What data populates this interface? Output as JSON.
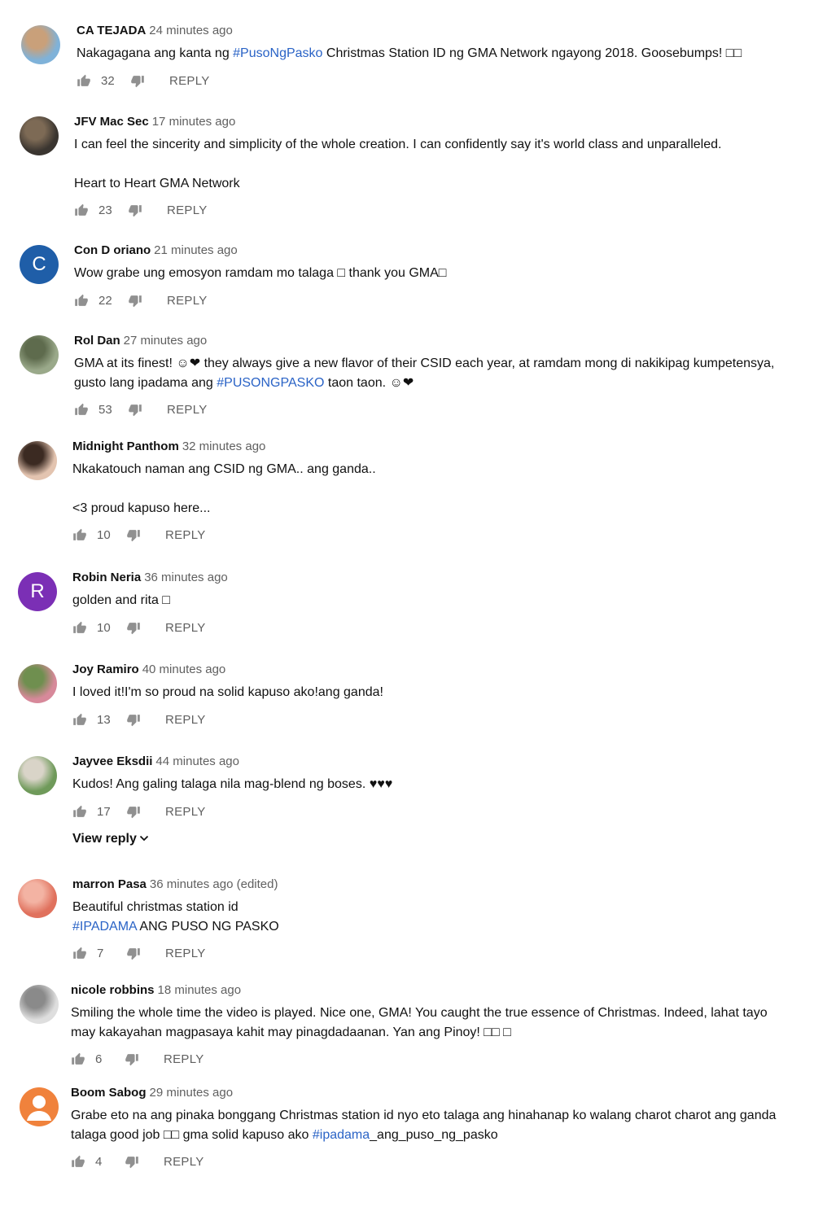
{
  "reply_label": "REPLY",
  "comments": [
    {
      "author": "CA TEJADA",
      "time": "24 minutes ago",
      "likes": "32",
      "avatar": {
        "kind": "photo",
        "colors": [
          "#7fb2d9",
          "#c9a07a"
        ]
      },
      "paragraphs": [
        [
          {
            "t": "Nakagagana ang kanta ng "
          },
          {
            "t": "#PusoNgPasko",
            "link": true
          },
          {
            "t": " Christmas Station ID ng GMA Network ngayong 2018. Goosebumps! □□"
          }
        ]
      ]
    },
    {
      "author": "JFV Mac Sec",
      "time": "17 minutes ago",
      "likes": "23",
      "avatar": {
        "kind": "photo",
        "colors": [
          "#3a3530",
          "#7d6a55"
        ]
      },
      "paragraphs": [
        [
          {
            "t": "I can feel the sincerity and simplicity of the whole creation. I can confidently say it's world class and unparalleled."
          }
        ],
        [
          {
            "t": "Heart to Heart GMA Network"
          }
        ]
      ]
    },
    {
      "author": "Con D oriano",
      "time": "21 minutes ago",
      "likes": "22",
      "avatar": {
        "kind": "letter",
        "letter": "C",
        "color": "#1f5ea8"
      },
      "paragraphs": [
        [
          {
            "t": "Wow grabe ung emosyon ramdam mo talaga □ thank you GMA□"
          }
        ]
      ]
    },
    {
      "author": "Rol Dan",
      "time": "27 minutes ago",
      "likes": "53",
      "avatar": {
        "kind": "photo",
        "colors": [
          "#9aa98a",
          "#5e6b4d"
        ]
      },
      "paragraphs": [
        [
          {
            "t": "GMA at its finest! ☺❤ they always give a new flavor of their CSID each year, at ramdam mong di nakikipag kumpetensya,\ngusto lang ipadama ang "
          },
          {
            "t": "#PUSONGPASKO",
            "link": true
          },
          {
            "t": " taon taon. ☺❤"
          }
        ]
      ]
    },
    {
      "author": "Midnight Panthom",
      "time": "32 minutes ago",
      "likes": "10",
      "avatar": {
        "kind": "photo",
        "colors": [
          "#e3c4b0",
          "#3b2a22"
        ]
      },
      "paragraphs": [
        [
          {
            "t": "Nkakatouch naman ang CSID ng GMA.. ang ganda.."
          }
        ],
        [
          {
            "t": "<3 proud kapuso here..."
          }
        ]
      ]
    },
    {
      "author": "Robin Neria",
      "time": "36 minutes ago",
      "likes": "10",
      "avatar": {
        "kind": "letter",
        "letter": "R",
        "color": "#7b2fb5"
      },
      "paragraphs": [
        [
          {
            "t": "golden and rita □"
          }
        ]
      ]
    },
    {
      "author": "Joy Ramiro",
      "time": "40 minutes ago",
      "likes": "13",
      "avatar": {
        "kind": "photo",
        "colors": [
          "#d7899a",
          "#6f8f4f"
        ]
      },
      "paragraphs": [
        [
          {
            "t": "I loved it!I'm so proud na solid kapuso ako!ang ganda!"
          }
        ]
      ]
    },
    {
      "author": "Jayvee Eksdii",
      "time": "44 minutes ago",
      "likes": "17",
      "avatar": {
        "kind": "photo",
        "colors": [
          "#6f9a5a",
          "#d9d4c8"
        ]
      },
      "paragraphs": [
        [
          {
            "t": "Kudos! Ang galing talaga nila mag-blend ng boses. ♥♥♥"
          }
        ]
      ],
      "view_reply": "View reply"
    },
    {
      "author": "marron Pasa",
      "time": "36 minutes ago (edited)",
      "likes": "7",
      "avatar": {
        "kind": "photo",
        "colors": [
          "#e0715d",
          "#f3b3a3"
        ]
      },
      "paragraphs": [
        [
          {
            "t": "Beautiful christmas station id\n"
          },
          {
            "t": "#IPADAMA",
            "link": true
          },
          {
            "t": " ANG PUSO NG PASKO"
          }
        ]
      ]
    },
    {
      "author": "nicole robbins",
      "time": "18 minutes ago",
      "likes": "6",
      "avatar": {
        "kind": "photo",
        "colors": [
          "#dedede",
          "#8a8a8a"
        ]
      },
      "paragraphs": [
        [
          {
            "t": "Smiling the whole time the video is played. Nice one, GMA! You caught the true essence of Christmas. Indeed, lahat tayo\nmay kakayahan magpasaya kahit may pinagdadaanan. Yan ang Pinoy! □□ □"
          }
        ]
      ]
    },
    {
      "author": "Boom Sabog",
      "time": "29 minutes ago",
      "likes": "4",
      "avatar": {
        "kind": "default",
        "color": "#f0823c"
      },
      "paragraphs": [
        [
          {
            "t": "Grabe eto na ang pinaka bonggang Christmas station id nyo eto talaga ang hinahanap ko walang charot charot ang ganda\ntalaga good job □□ gma solid kapuso ako "
          },
          {
            "t": "#ipadama",
            "link": true
          },
          {
            "t": "_ang_puso_ng_pasko"
          }
        ]
      ]
    }
  ]
}
